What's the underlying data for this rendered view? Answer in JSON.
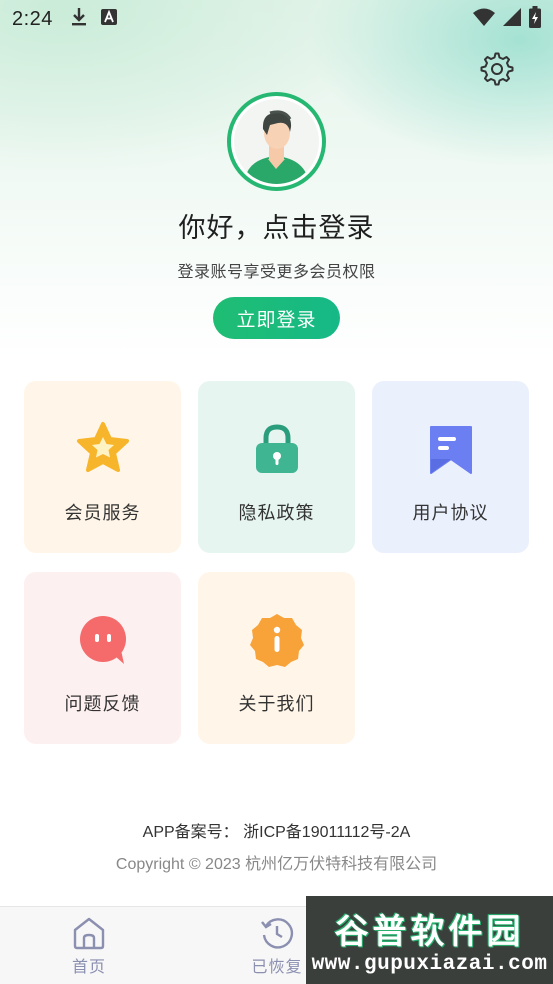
{
  "status_bar": {
    "time": "2:24",
    "icons": [
      "download-icon",
      "keyboard-a-icon",
      "wifi-icon",
      "signal-icon",
      "battery-charging-icon"
    ]
  },
  "header": {
    "settings_icon": "gear-icon",
    "greeting": "你好，点击登录",
    "subtitle": "登录账号享受更多会员权限",
    "login_button": "立即登录"
  },
  "grid": {
    "items": [
      {
        "label": "会员服务",
        "icon": "star-icon",
        "bg": "#fff6e9"
      },
      {
        "label": "隐私政策",
        "icon": "lock-icon",
        "bg": "#e6f5ef"
      },
      {
        "label": "用户协议",
        "icon": "bookmark-document-icon",
        "bg": "#ebf0fd"
      },
      {
        "label": "问题反馈",
        "icon": "chat-bubble-icon",
        "bg": "#fdf0f0"
      },
      {
        "label": "关于我们",
        "icon": "info-icon",
        "bg": "#fff6e9"
      }
    ]
  },
  "footer": {
    "icp": "APP备案号： 浙ICP备19011112号-2A",
    "copyright": "Copyright © 2023 杭州亿万伏特科技有限公司"
  },
  "bottom_nav": {
    "items": [
      {
        "label": "首页",
        "icon": "home-icon"
      },
      {
        "label": "已恢复",
        "icon": "history-clock-icon"
      }
    ]
  },
  "watermark": {
    "brand": "谷普软件园",
    "url": "www.gupuxiazai.com"
  },
  "colors": {
    "accent": "#1fbd73",
    "nav_label": "#8b8fb0"
  }
}
